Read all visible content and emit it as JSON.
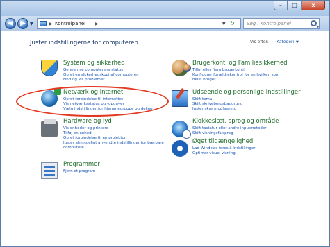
{
  "window": {
    "controls": {
      "minimize": "–",
      "maximize": "□",
      "close": "x"
    }
  },
  "address": {
    "back_glyph": "◀",
    "forward_glyph": "▶",
    "path": "Kontrolpanel",
    "search_placeholder": "Søg i Kontrolpanel"
  },
  "header": {
    "title": "Juster indstillingerne for computeren",
    "view_label": "Vis efter:",
    "view_value": "Kategori"
  },
  "categories": {
    "system": {
      "title": "System og sikkerhed",
      "links": [
        "Gennemse computerens status",
        "Opret en sikkerhedskopi af computeren",
        "Find og løs problemer"
      ]
    },
    "network": {
      "title": "Netværk og internet",
      "links": [
        "Opret forbindelse til internettet",
        "Vis netværksstatus og -opgaver",
        "Vælg indstillinger for hjemmegruppe og deling"
      ]
    },
    "hardware": {
      "title": "Hardware og lyd",
      "links": [
        "Vis enheder og printere",
        "Tilføj en enhed",
        "Opret forbindelse til en projektor",
        "Juster almindeligt anvendte indstillinger for bærbare",
        "computere"
      ]
    },
    "programs": {
      "title": "Programmer",
      "links": [
        "Fjern et program"
      ]
    },
    "users": {
      "title": "Brugerkonti og Familiesikkerhed",
      "links": [
        "Tilføj eller fjern brugerkonti",
        "Konfigurer forældrekontrol for en hvilken som",
        "helst bruger"
      ]
    },
    "appearance": {
      "title": "Udseende og personlige indstillinger",
      "links": [
        "Skift tema",
        "Skift skrivebordsbaggrund",
        "Juster skærmopløsning"
      ]
    },
    "clock": {
      "title": "Klokkeslæt, sprog og område",
      "links": [
        "Skift tastatur eller andre inputmetoder",
        "Skift visningsfalsprog"
      ]
    },
    "ease": {
      "title": "Øget tilgængelighed",
      "links": [
        "Lad Windows foreslå indstillinger",
        "Optimer visuel visning"
      ]
    }
  },
  "colors": {
    "highlight": "#e23a22",
    "link": "#1c56b3",
    "category_title": "#1e6b2b"
  }
}
